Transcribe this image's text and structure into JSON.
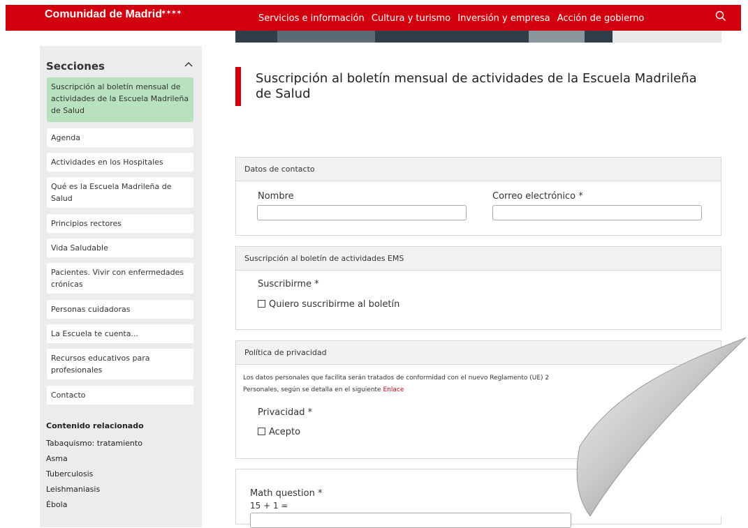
{
  "header": {
    "brand": "Comunidad de Madrid",
    "stars": "✶✶✶✶",
    "nav": [
      "Servicios e información",
      "Cultura y turismo",
      "Inversión y empresa",
      "Acción de gobierno"
    ]
  },
  "sidebar": {
    "title": "Secciones",
    "items": [
      "Suscripción al boletín mensual de actividades de la Escuela Madrileña de Salud",
      "Agenda",
      "Actividades en los Hospitales",
      "Qué es la Escuela Madrileña de Salud",
      "Principios rectores",
      "Vida Saludable",
      "Pacientes. Vivir con enfermedades crónicas",
      "Personas cuidadoras",
      "La Escuela te cuenta...",
      "Recursos educativos para profesionales",
      "Contacto"
    ],
    "related_title": "Contenido relacionado",
    "related": [
      "Tabaquismo: tratamiento",
      "Asma",
      "Tuberculosis",
      "Leishmaniasis",
      "Ébola"
    ]
  },
  "main": {
    "title": "Suscripción al boletín mensual de actividades de la Escuela Madrileña de Salud",
    "contact": {
      "heading": "Datos de contacto",
      "name_label": "Nombre",
      "email_label": "Correo electrónico *",
      "name_value": "",
      "email_value": ""
    },
    "subscription": {
      "heading": "Suscripción al boletín de actividades EMS",
      "label": "Suscribirme *",
      "checkbox": "Quiero suscribirme al boletín"
    },
    "privacy": {
      "heading": "Política de privacidad",
      "text1": "Los datos personales que facilita serán tratados de conformidad con el nuevo Reglamento (UE) 2",
      "text2": "Personales, según se detalla en el siguiente",
      "link": "Enlace",
      "label": "Privacidad *",
      "checkbox": "Acepto"
    },
    "math": {
      "label": "Math question *",
      "question": "15 + 1 ="
    }
  },
  "colors": {
    "brand_red": "#d2000f",
    "active_green": "#b8e1bf",
    "sidebar_bg": "#ececec"
  }
}
